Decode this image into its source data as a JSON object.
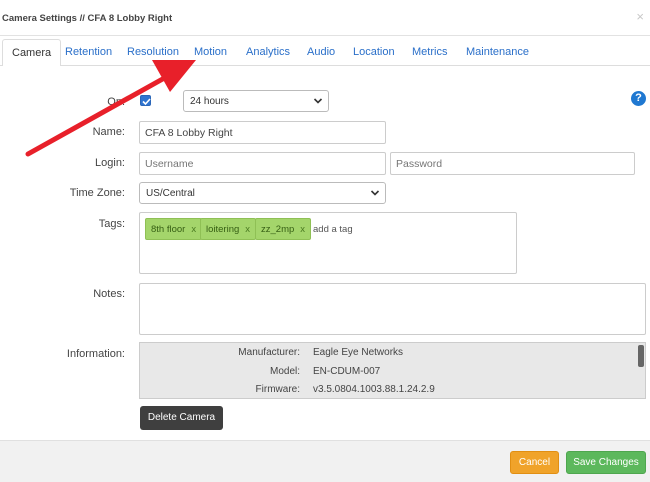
{
  "window": {
    "title": "Camera Settings // CFA 8 Lobby Right",
    "close_glyph": "×"
  },
  "tabs": [
    {
      "label": "Camera",
      "active": true
    },
    {
      "label": "Retention"
    },
    {
      "label": "Resolution"
    },
    {
      "label": "Motion"
    },
    {
      "label": "Analytics"
    },
    {
      "label": "Audio"
    },
    {
      "label": "Location"
    },
    {
      "label": "Metrics"
    },
    {
      "label": "Maintenance"
    }
  ],
  "form": {
    "on_label": "On:",
    "on_checked": true,
    "on_duration": "24 hours",
    "name_label": "Name:",
    "name_value": "CFA 8 Lobby Right",
    "login_label": "Login:",
    "username_placeholder": "Username",
    "password_placeholder": "Password",
    "timezone_label": "Time Zone:",
    "timezone_value": "US/Central",
    "tags_label": "Tags:",
    "tags": [
      "8th floor",
      "loitering",
      "zz_2mp"
    ],
    "tag_remove_glyph": "x",
    "tag_input_placeholder": "add a tag",
    "notes_label": "Notes:",
    "notes_value": "",
    "information_label": "Information:",
    "information": [
      {
        "key": "Manufacturer:",
        "value": "Eagle Eye Networks"
      },
      {
        "key": "Model:",
        "value": "EN-CDUM-007"
      },
      {
        "key": "Firmware:",
        "value": "v3.5.0804.1003.88.1.24.2.9"
      }
    ],
    "help_glyph": "?"
  },
  "buttons": {
    "delete": "Delete Camera",
    "cancel": "Cancel",
    "save": "Save Changes"
  },
  "colors": {
    "annotation_arrow": "#e8202a",
    "tag_background": "#a4d56b",
    "cancel_button": "#f0a32a",
    "save_button": "#5cb85c",
    "tab_link": "#2a6fc9"
  },
  "icons": {
    "help": "question-circle-icon",
    "close": "close-icon",
    "select_arrow": "chevron-down-icon",
    "checkbox": "check-icon",
    "annotation": "red-arrow-icon"
  }
}
